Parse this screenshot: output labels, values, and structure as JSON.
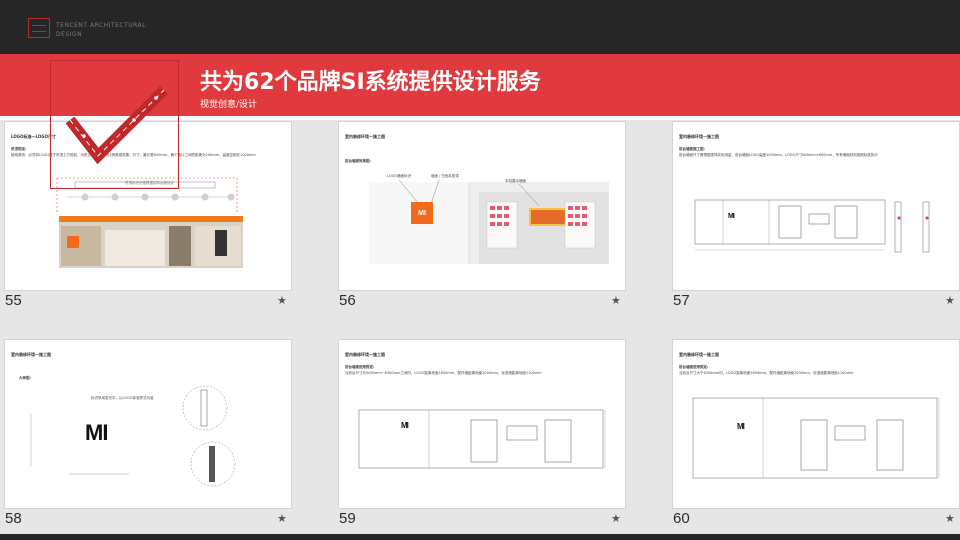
{
  "header": {
    "small_line1": "TENCENT ARCHITECTURAL",
    "small_line2": "DESIGN"
  },
  "banner": {
    "title": "共为62个品牌SI系统提供设计服务",
    "subtitle": "视觉创意/设计"
  },
  "colors": {
    "accent_red": "#e03a3e",
    "brand_orange": "#f07a1a",
    "topbar_dark": "#262626"
  },
  "pages": [
    {
      "number": "55",
      "header": "LOGO标准—LOGO尺寸",
      "section": "吊顶规定:",
      "note": "使用原则：必须将LOGO置于吊顶上方规划，为防止破坏LOGO比例美观效果，尺寸：最长宽600mm，两个图片之间的距离为200mm，高度控制在1000mm",
      "dim_label": "吊顶标识长度根据实际店面设定",
      "logo": "mi"
    },
    {
      "number": "56",
      "header": "室内装修环境—施工图",
      "section": "前台墙面效果图:",
      "callout1": "LOGO墙面标识",
      "callout2": "墙面 / 白色乳胶漆",
      "callout3": "手机展示墙面",
      "logo": "MI"
    },
    {
      "number": "57",
      "header": "室内装修环境—施工图",
      "section": "前台墙面施工图:",
      "note": "前台墙面尺寸需根据现场实际测量，前台墙面LOGO高度1000mm，LOGO尺寸600mm×600mm，所有墙面材料按照标准执行",
      "logo": "MI"
    },
    {
      "number": "58",
      "header": "室内装修环境—施工图",
      "section": "大样图:",
      "note": "标识采用发光字，以LOGO标准样式为准",
      "logo": "MI"
    },
    {
      "number": "59",
      "header": "室内装修环境—施工图",
      "section": "前台墙面使用规定:",
      "note": "当前台尺寸为5050mm~6300mm之间时，LOGO距离地面1650mm，配件墙距离地面1000mm，标准墙距离地面1100mm",
      "logo": "MI"
    },
    {
      "number": "60",
      "header": "室内装修环境—施工图",
      "section": "前台墙面使用规定:",
      "note": "当前台尺寸大于6300mm时，LOGO距离地面1650mm，配件墙距离地面1000mm，标准墙距离地面1100mm",
      "logo": "MI"
    }
  ]
}
